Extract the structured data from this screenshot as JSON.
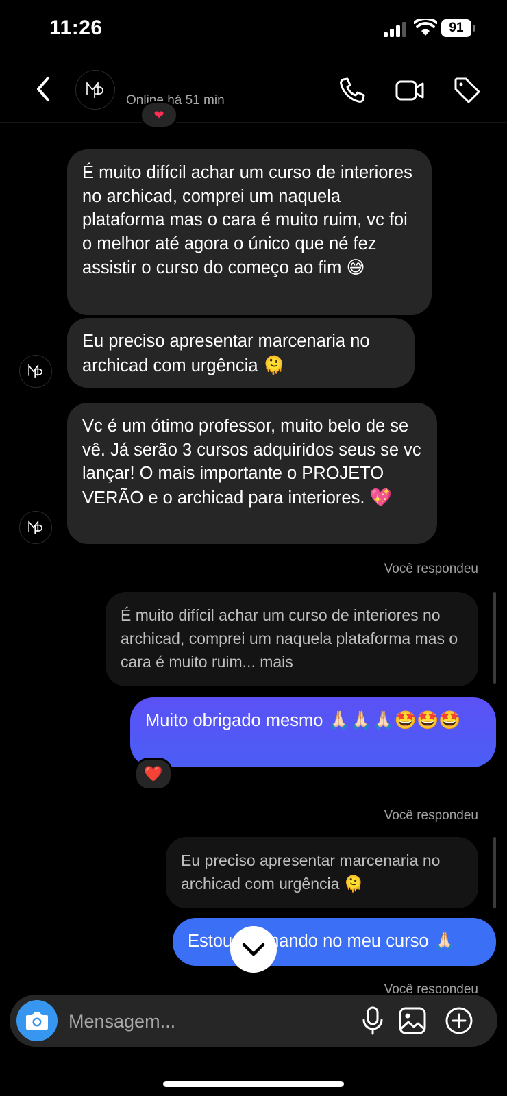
{
  "status": {
    "time": "11:26",
    "battery": "91"
  },
  "header": {
    "status": "Online há 51 min",
    "avatar_monogram": "MP"
  },
  "messages_in": [
    {
      "text": "É muito difícil achar um curso de interiores no archicad, comprei um naquela plataforma mas o cara é muito ruim, vc foi o melhor até agora o único que né fez assistir o curso do começo ao fim",
      "emoji": "😅"
    },
    {
      "text": "Eu preciso apresentar marcenaria no archicad com urgência",
      "emoji": "🫠"
    },
    {
      "text": "Vc é um ótimo professor, muito belo de se vê. Já serão 3 cursos adquiridos seus se vc lançar! O mais  importante o PROJETO VERÃO e o archicad para interiores.",
      "emoji": "💖"
    }
  ],
  "replies": [
    {
      "label": "Você respondeu",
      "quoted": "É muito difícil achar um curso de interiores no archicad, comprei um naquela plataforma mas o cara é muito ruim... mais",
      "quoted_emoji": "",
      "text": "Muito obrigado mesmo",
      "emoji": "🙏🏻🙏🏻🙏🏻🤩🤩🤩",
      "reaction": "❤️"
    },
    {
      "label": "Você respondeu",
      "quoted": "Eu preciso apresentar marcenaria no archicad com urgência",
      "quoted_emoji": "🫠",
      "text": "Estou ensinando no meu curso",
      "emoji": "🙏🏻"
    },
    {
      "label": "Você respondeu"
    }
  ],
  "composer": {
    "placeholder": "Mensagem..."
  },
  "icons": {
    "back": "chevron-left-icon",
    "phone": "phone-icon",
    "video": "video-icon",
    "tag": "tag-icon",
    "camera": "camera-icon",
    "mic": "microphone-icon",
    "gallery": "image-icon",
    "add": "plus-circle-icon",
    "scroll": "chevron-down-icon"
  },
  "colors": {
    "outgoing_top": "#5b51f5",
    "outgoing_bottom": "#3b6ff6",
    "incoming": "#262626",
    "camera": "#3797f0"
  }
}
